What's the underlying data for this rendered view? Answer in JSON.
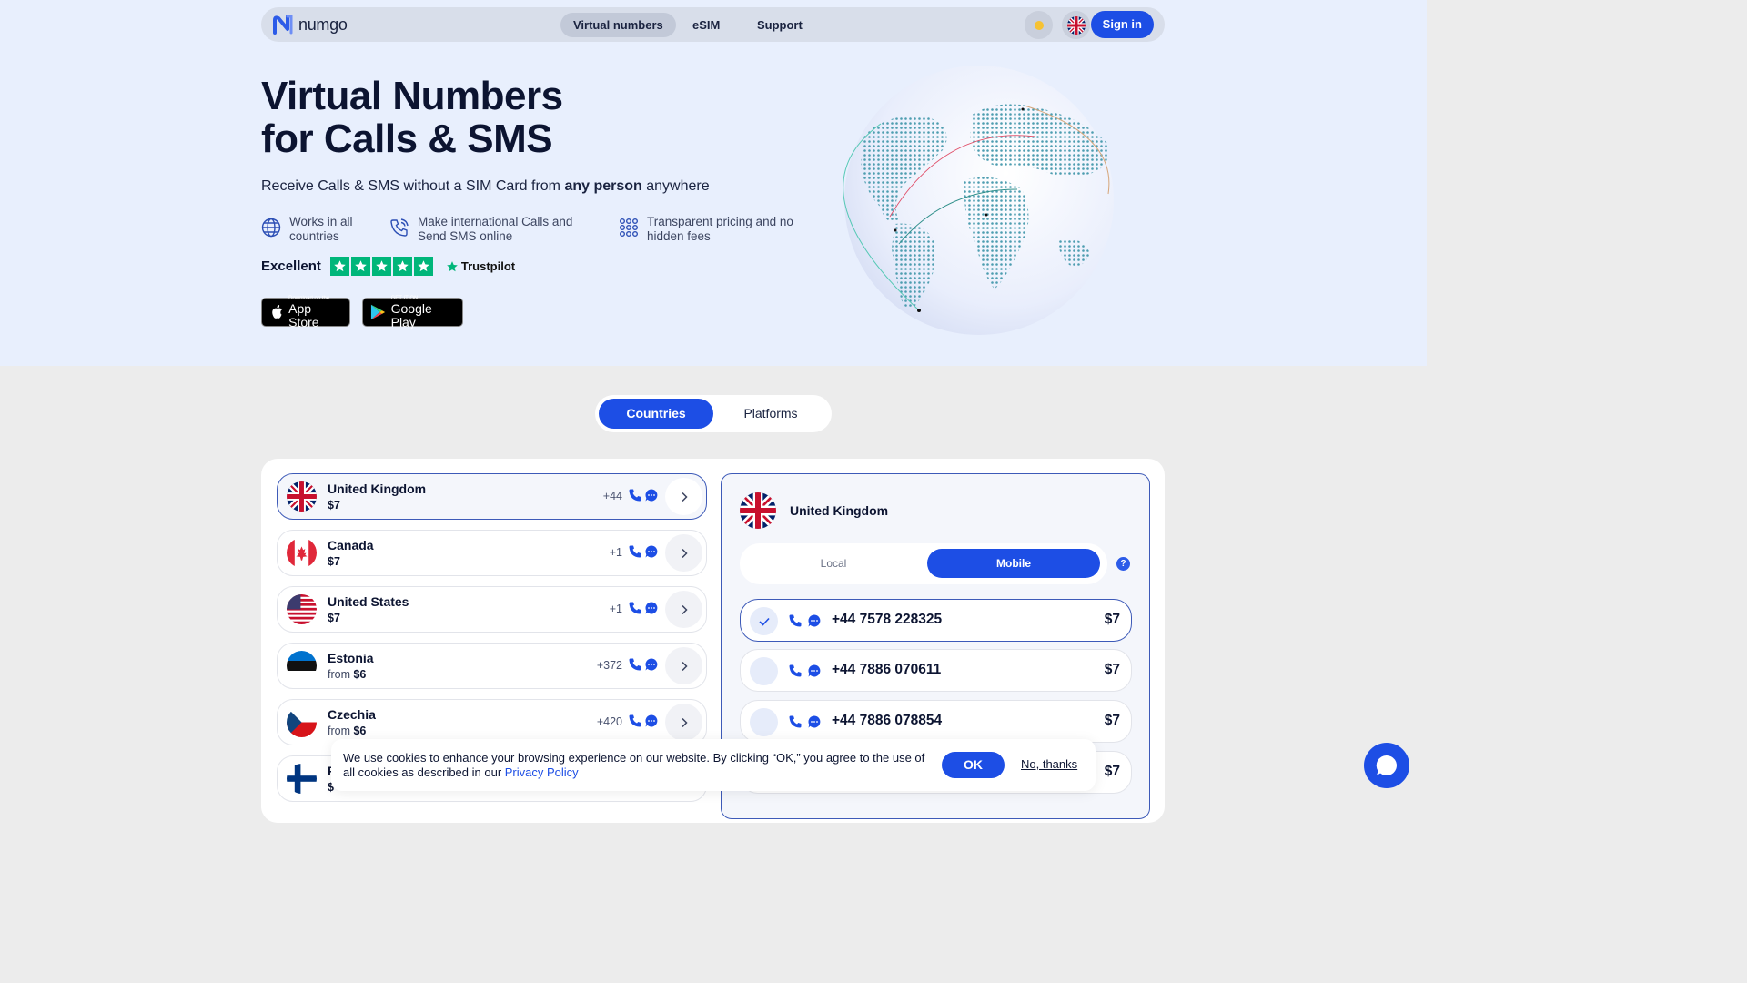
{
  "header": {
    "logo_text": "numgo",
    "nav": [
      "Virtual numbers",
      "eSIM",
      "Support"
    ],
    "sign_in": "Sign in"
  },
  "hero": {
    "title_line1": "Virtual Numbers",
    "title_line2": "for Calls & SMS",
    "subtitle_pre": "Receive Calls & SMS without a SIM Card from ",
    "subtitle_bold": "any person",
    "subtitle_post": " anywhere",
    "features": [
      {
        "icon": "globe-icon",
        "line1": "Works in all",
        "line2": "countries"
      },
      {
        "icon": "phone-call-icon",
        "line1": "Make international Calls and",
        "line2": "Send SMS online"
      },
      {
        "icon": "dots-grid-icon",
        "line1": "Transparent pricing and no",
        "line2": "hidden fees"
      }
    ],
    "rating_word": "Excellent",
    "rating_stars": 5,
    "trustpilot": "Trustpilot",
    "app_store": {
      "small": "Download on the",
      "big": "App Store"
    },
    "google_play": {
      "small": "GET IT ON",
      "big": "Google Play"
    }
  },
  "tabs": {
    "active": "Countries",
    "inactive": "Platforms"
  },
  "countries": [
    {
      "name": "United Kingdom",
      "price_prefix": "",
      "price": "$7",
      "code": "+44",
      "flag": "uk"
    },
    {
      "name": "Canada",
      "price_prefix": "",
      "price": "$7",
      "code": "+1",
      "flag": "ca"
    },
    {
      "name": "United States",
      "price_prefix": "",
      "price": "$7",
      "code": "+1",
      "flag": "us"
    },
    {
      "name": "Estonia",
      "price_prefix": "from ",
      "price": "$6",
      "code": "+372",
      "flag": "ee"
    },
    {
      "name": "Czechia",
      "price_prefix": "from ",
      "price": "$6",
      "code": "+420",
      "flag": "cz"
    },
    {
      "name": "F",
      "price_prefix": "",
      "price": "$",
      "code": "",
      "flag": "fi"
    }
  ],
  "detail": {
    "country": "United Kingdom",
    "type_local": "Local",
    "type_mobile": "Mobile",
    "help": "?",
    "numbers": [
      {
        "number": "+44 7578 228325",
        "price": "$7"
      },
      {
        "number": "+44 7886 070611",
        "price": "$7"
      },
      {
        "number": "+44 7886 078854",
        "price": "$7"
      },
      {
        "number": "",
        "price": "$7"
      }
    ]
  },
  "cookie": {
    "text": "We use cookies to enhance your browsing experience on our website. By clicking “OK,” you agree to the use of all cookies as described in our ",
    "link": "Privacy Policy",
    "ok": "OK",
    "decline": "No, thanks"
  },
  "colors": {
    "accent": "#1d4ee5",
    "hero_bg": "#e8effd",
    "trustpilot_green": "#00b67a"
  }
}
